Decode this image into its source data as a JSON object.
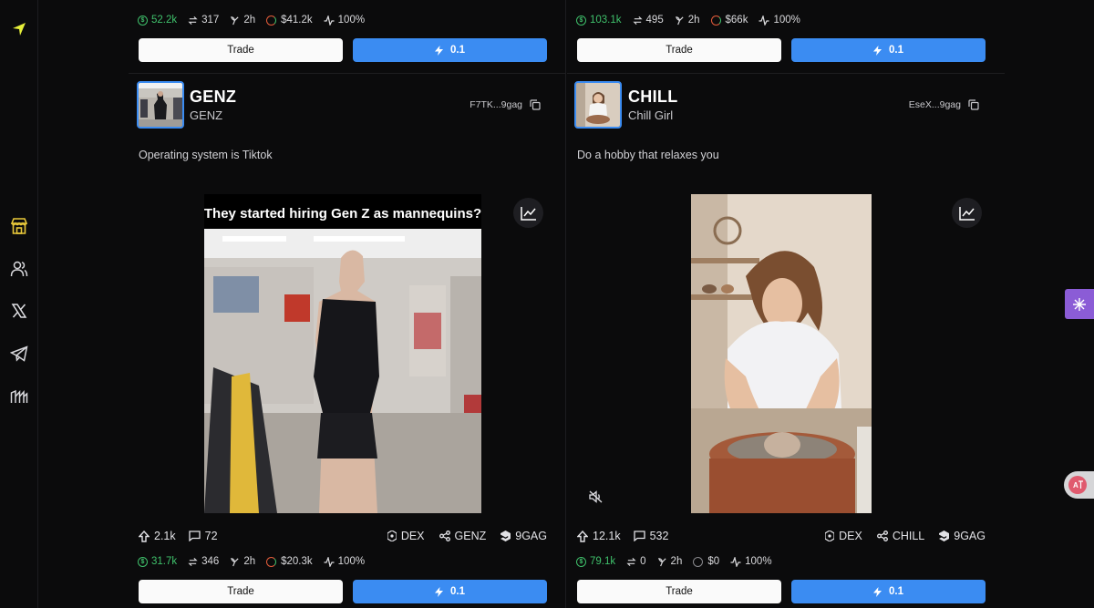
{
  "sidebar": {
    "items": [
      {
        "icon": "navigation-arrow-icon"
      },
      {
        "icon": "store-icon"
      },
      {
        "icon": "users-icon"
      },
      {
        "icon": "x-logo-icon"
      },
      {
        "icon": "telegram-icon"
      },
      {
        "icon": "meteora-icon"
      }
    ]
  },
  "posts": [
    {
      "top_stats": {
        "market_cap": "52.2k",
        "trades": "317",
        "age": "2h",
        "volume": "$41.2k",
        "pct": "100%"
      },
      "trade_label": "Trade",
      "buy_amount": "0.1"
    },
    {
      "top_stats": {
        "market_cap": "103.1k",
        "trades": "495",
        "age": "2h",
        "volume": "$66k",
        "pct": "100%"
      },
      "trade_label": "Trade",
      "buy_amount": "0.1"
    },
    {
      "ticker": "GENZ",
      "name": "GENZ",
      "address": "F7TK...9gag",
      "description": "Operating system is Tiktok",
      "meme_caption": "They started hiring Gen Z as mannequins?",
      "upvotes": "2.1k",
      "comments": "72",
      "dex_label": "DEX",
      "share_label": "GENZ",
      "source_label": "9GAG",
      "stats": {
        "market_cap": "31.7k",
        "trades": "346",
        "age": "2h",
        "volume": "$20.3k",
        "pct": "100%"
      },
      "trade_label": "Trade",
      "buy_amount": "0.1"
    },
    {
      "ticker": "CHILL",
      "name": "Chill Girl",
      "address": "EseX...9gag",
      "description": "Do a hobby that relaxes you",
      "upvotes": "12.1k",
      "comments": "532",
      "dex_label": "DEX",
      "share_label": "CHILL",
      "source_label": "9GAG",
      "stats": {
        "market_cap": "79.1k",
        "trades": "0",
        "age": "2h",
        "volume": "$0",
        "pct": "100%"
      },
      "trade_label": "Trade",
      "buy_amount": "0.1"
    }
  ],
  "colors": {
    "accent": "#3b8cf2",
    "positive": "#3fc06b",
    "background": "#0b0b0c",
    "floating": "#8b5cd6"
  }
}
